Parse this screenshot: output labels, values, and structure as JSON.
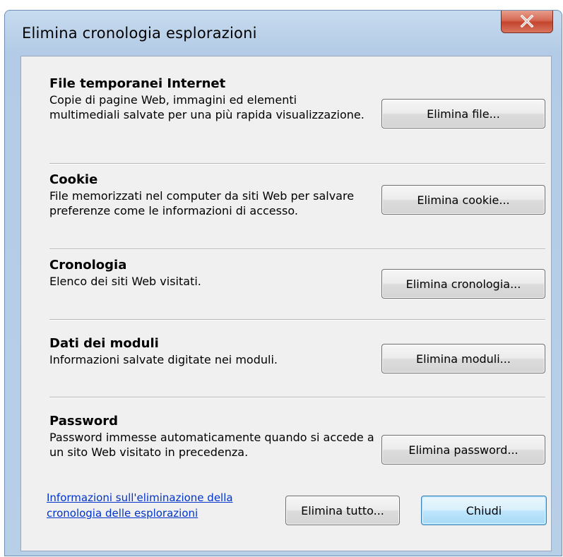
{
  "window": {
    "title": "Elimina cronologia esplorazioni"
  },
  "sections": [
    {
      "title": "File temporanei Internet",
      "description": "Copie di pagine Web, immagini ed elementi multimediali salvate per una più rapida visualizzazione.",
      "button": "Elimina file..."
    },
    {
      "title": "Cookie",
      "description": "File memorizzati nel computer da siti Web per salvare preferenze come le informazioni di accesso.",
      "button": "Elimina cookie..."
    },
    {
      "title": "Cronologia",
      "description": "Elenco dei siti Web visitati.",
      "button": "Elimina cronologia..."
    },
    {
      "title": "Dati dei moduli",
      "description": "Informazioni salvate digitate nei moduli.",
      "button": "Elimina moduli..."
    },
    {
      "title": "Password",
      "description": "Password immesse automaticamente quando si accede a un sito Web visitato in precedenza.",
      "button": "Elimina password..."
    }
  ],
  "footer": {
    "link": "Informazioni sull'eliminazione della cronologia delle esplorazioni",
    "delete_all": "Elimina tutto...",
    "close": "Chiudi"
  }
}
